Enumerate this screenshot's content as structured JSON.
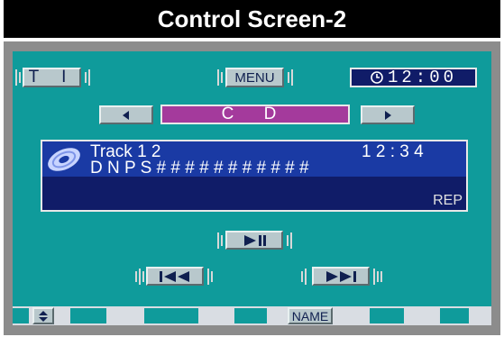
{
  "title": "Control Screen-2",
  "top_row": {
    "ti_label": "T I",
    "menu_label": "MENU",
    "clock": "12:00",
    "clock_icon": "clock-icon"
  },
  "source_row": {
    "prev_icon": "triangle-left-icon",
    "source_label": "C D",
    "next_icon": "triangle-right-icon"
  },
  "info": {
    "disc_icon": "disc-icon",
    "track_label": "Track 1 2",
    "time": "1 2 : 3 4",
    "dnps_text": "D N P S # # # # # # # # # # #",
    "mode": "REP"
  },
  "controls": {
    "play_pause_icon": "play-pause-icon",
    "skip_back_icon": "skip-back-icon",
    "skip_forward_icon": "skip-forward-icon"
  },
  "bottom": {
    "updown_icon": "up-down-arrow-icon",
    "name_label": "NAME"
  },
  "colors": {
    "screen_bg": "#0f9b9b",
    "display_bg": "#101c68",
    "source_bg": "#a43a9c",
    "button_bg": "#b8c8cc"
  }
}
